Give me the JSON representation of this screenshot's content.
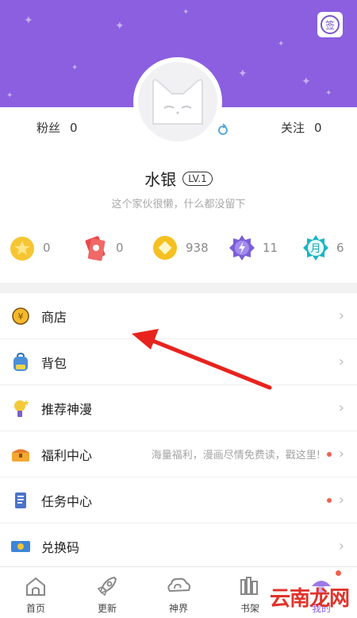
{
  "header": {
    "sign_icon": "sign-in-icon",
    "sign_text": "签"
  },
  "profile": {
    "fans_label": "粉丝",
    "fans_count": "0",
    "follow_label": "关注",
    "follow_count": "0",
    "name": "水银",
    "level": "LV.1",
    "bio": "这个家伙很懒，什么都没留下"
  },
  "currencies": [
    {
      "icon": "star-coin-icon",
      "value": "0"
    },
    {
      "icon": "red-ticket-icon",
      "value": "0"
    },
    {
      "icon": "gold-coin-icon",
      "value": "938"
    },
    {
      "icon": "purple-badge-icon",
      "value": "11"
    },
    {
      "icon": "monthly-ticket-icon",
      "value": "6",
      "icon_text": "月"
    }
  ],
  "menu": [
    {
      "label": "商店",
      "icon": "shop-coin-icon"
    },
    {
      "label": "背包",
      "icon": "backpack-icon"
    },
    {
      "label": "推荐神漫",
      "icon": "recommend-icon"
    },
    {
      "label": "福利中心",
      "icon": "treasure-chest-icon",
      "hint": "海量福利，漫画尽情免费读，戳这里!"
    },
    {
      "label": "任务中心",
      "icon": "task-scroll-icon"
    },
    {
      "label": "兑换码",
      "icon": "redeem-ticket-icon"
    }
  ],
  "tabs": [
    {
      "label": "首页",
      "icon": "home-icon"
    },
    {
      "label": "更新",
      "icon": "rocket-icon"
    },
    {
      "label": "神界",
      "icon": "cloud-swirl-icon"
    },
    {
      "label": "书架",
      "icon": "bookshelf-icon"
    },
    {
      "label": "我的",
      "icon": "profile-mushroom-icon"
    }
  ],
  "watermark": "云南龙网",
  "colors": {
    "brand_purple": "#8b5fe0",
    "red_dot": "#f0614f",
    "arrow_red": "#e8231d"
  }
}
